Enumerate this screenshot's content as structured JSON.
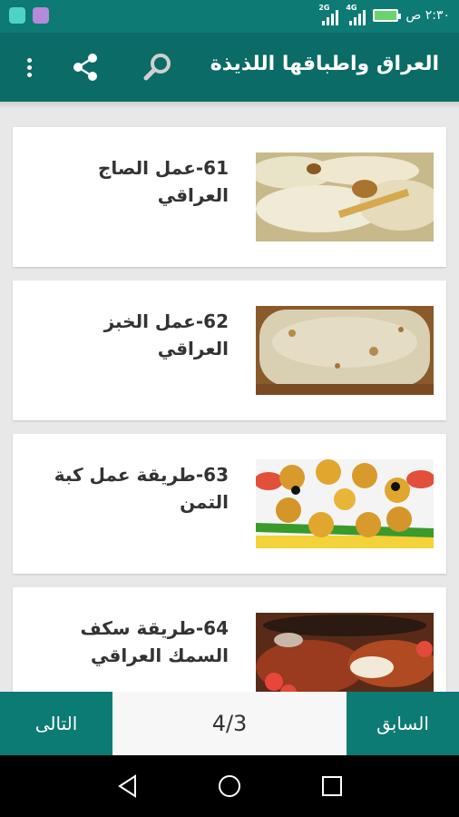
{
  "status_bar": {
    "time": "٢:٣٠ ص",
    "signal_1": "2G",
    "signal_2": "4G"
  },
  "app_bar": {
    "title": "العراق واطباقها اللذيذة"
  },
  "items": [
    {
      "title": "61-عمل الصاج العراقي",
      "image": "saj-bread-wraps"
    },
    {
      "title": "62-عمل الخبز العراقي",
      "image": "iraqi-flatbread"
    },
    {
      "title": "63-طريقة عمل كبة التمن",
      "image": "kubba-timman-platter"
    },
    {
      "title": "64-طريقة سكف السمك العراقي",
      "image": "grilled-fish"
    }
  ],
  "pagination": {
    "next_label": "التالى",
    "prev_label": "السابق",
    "page": "4/3"
  },
  "colors": {
    "status_bar": "#0d7a74",
    "app_bar": "#0b6b66",
    "nav_button": "#0b7b74",
    "background": "#e8e8e8"
  }
}
